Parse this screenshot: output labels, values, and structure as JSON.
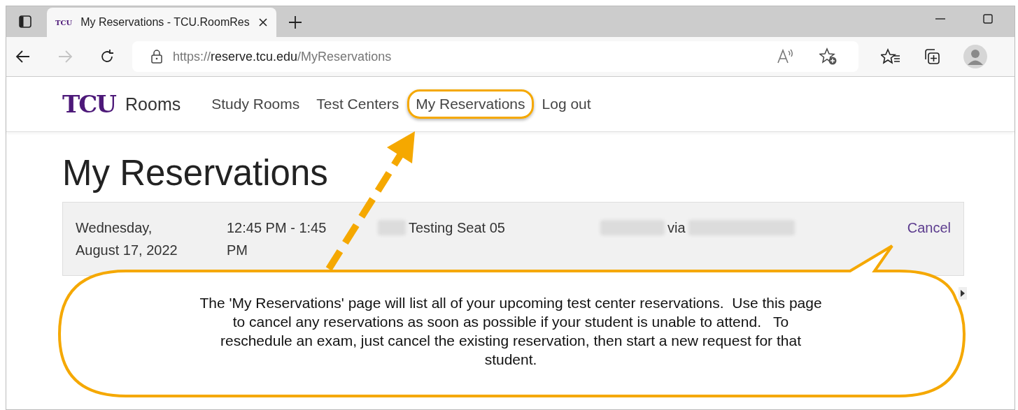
{
  "browser": {
    "tab": {
      "title": "My Reservations - TCU.RoomRes",
      "favicon": "TCU",
      "selected": true
    },
    "url": {
      "scheme": "https://",
      "host": "reserve.tcu.edu",
      "path": "/MyReservations"
    }
  },
  "nav": {
    "logo": "TCU",
    "brand": "Rooms",
    "items": [
      {
        "label": "Study Rooms",
        "highlighted": false
      },
      {
        "label": "Test Centers",
        "highlighted": false
      },
      {
        "label": "My Reservations",
        "highlighted": true
      },
      {
        "label": "Log out",
        "highlighted": false
      }
    ]
  },
  "heading": "My Reservations",
  "reservations": [
    {
      "date": "Wednesday, August 17, 2022",
      "time": "12:45 PM - 1:45 PM",
      "room": "Testing Seat 05",
      "via": "via",
      "action": "Cancel"
    }
  ],
  "callout": {
    "text": "The 'My Reservations' page will list all of your upcoming test center reservations.  Use this page to cancel any reservations as soon as possible if your student is unable to attend.   To reschedule an exam, just cancel the existing reservation, then start a new request for that student."
  }
}
